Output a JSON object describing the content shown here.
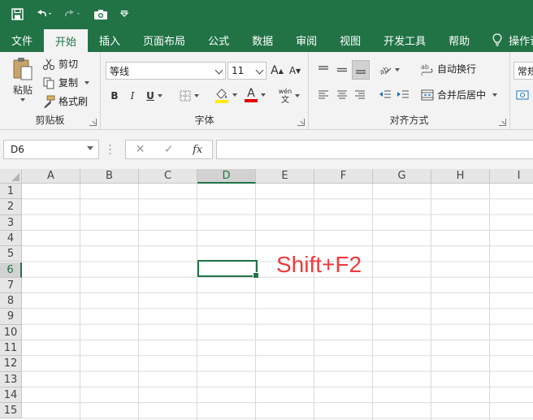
{
  "quick_access": {
    "save_icon": "save-icon",
    "undo_icon": "undo-icon",
    "redo_icon": "redo-icon",
    "camera_icon": "camera-icon",
    "customize_icon": "customize-qat-icon"
  },
  "tabs": [
    {
      "label": "文件"
    },
    {
      "label": "开始"
    },
    {
      "label": "插入"
    },
    {
      "label": "页面布局"
    },
    {
      "label": "公式"
    },
    {
      "label": "数据"
    },
    {
      "label": "审阅"
    },
    {
      "label": "视图"
    },
    {
      "label": "开发工具"
    },
    {
      "label": "帮助"
    }
  ],
  "help_search": {
    "label": "操作说明"
  },
  "ribbon": {
    "clipboard": {
      "label": "剪贴板",
      "paste": "粘贴",
      "cut": "剪切",
      "copy": "复制",
      "format_painter": "格式刷"
    },
    "font": {
      "label": "字体",
      "font_name": "等线",
      "font_size": "11",
      "grow": "A",
      "shrink": "A",
      "bold": "B",
      "italic": "I",
      "underline": "U",
      "font_color_letter": "A",
      "phonetic_top": "wén",
      "phonetic_bottom": "文"
    },
    "alignment": {
      "label": "对齐方式",
      "wrap_text": "自动换行",
      "merge_center": "合并后居中"
    },
    "number": {
      "format": "常规"
    }
  },
  "formula_bar": {
    "name_box": "D6",
    "cancel": "✕",
    "enter": "✓",
    "fx": "fx",
    "value": ""
  },
  "grid": {
    "columns": [
      "A",
      "B",
      "C",
      "D",
      "E",
      "F",
      "G",
      "H",
      "I"
    ],
    "rows": [
      "1",
      "2",
      "3",
      "4",
      "5",
      "6",
      "7",
      "8",
      "9",
      "10",
      "11",
      "12",
      "13",
      "14",
      "15"
    ],
    "selected_column": "D",
    "selected_row": "6"
  },
  "annotation": "Shift+F2",
  "colors": {
    "accent": "#217346",
    "annotation": "#ee3b3b"
  }
}
